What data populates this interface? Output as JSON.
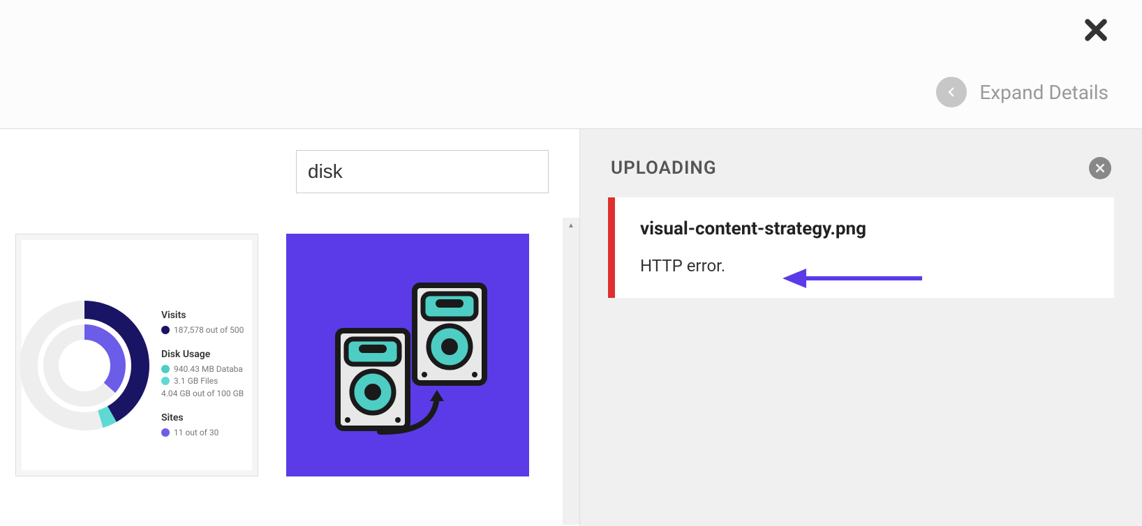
{
  "header": {
    "expand_label": "Expand Details"
  },
  "search": {
    "value": "disk"
  },
  "thumb1_stats": {
    "visits": {
      "title": "Visits",
      "line1": "187,578 out of 500"
    },
    "disk_usage": {
      "title": "Disk Usage",
      "line1": "940.43 MB Databa",
      "line2": "3.1 GB Files",
      "line3": "4.04 GB out of 100 GB"
    },
    "sites": {
      "title": "Sites",
      "line1": "11 out of 30"
    }
  },
  "upload": {
    "heading": "UPLOADING",
    "filename": "visual-content-strategy.png",
    "error_text": "HTTP error."
  }
}
